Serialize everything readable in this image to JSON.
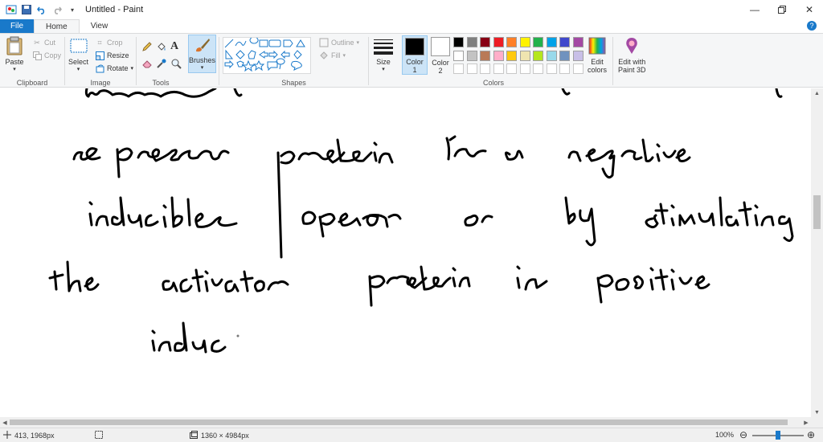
{
  "window": {
    "title": "Untitled - Paint"
  },
  "tabs": {
    "file": "File",
    "home": "Home",
    "view": "View"
  },
  "clipboard": {
    "paste": "Paste",
    "cut": "Cut",
    "copy": "Copy",
    "label": "Clipboard"
  },
  "image": {
    "select": "Select",
    "crop": "Crop",
    "resize": "Resize",
    "rotate": "Rotate",
    "label": "Image"
  },
  "tools": {
    "label": "Tools"
  },
  "brushes": {
    "label": "Brushes"
  },
  "shapes": {
    "outline": "Outline",
    "fill": "Fill",
    "label": "Shapes"
  },
  "size": {
    "label": "Size"
  },
  "colors": {
    "color1_label": "Color",
    "color1_num": "1",
    "color2_label": "Color",
    "color2_num": "2",
    "edit_label1": "Edit",
    "edit_label2": "colors",
    "paint3d_label1": "Edit with",
    "paint3d_label2": "Paint 3D",
    "label": "Colors",
    "color1": "#000000",
    "color2": "#ffffff",
    "palette_row1": [
      "#000000",
      "#7f7f7f",
      "#880015",
      "#ed1c24",
      "#ff7f27",
      "#fff200",
      "#22b14c",
      "#00a2e8",
      "#3f48cc",
      "#a349a4"
    ],
    "palette_row2": [
      "#ffffff",
      "#c3c3c3",
      "#b97a57",
      "#ffaec9",
      "#ffc90e",
      "#efe4b0",
      "#b5e61d",
      "#99d9ea",
      "#7092be",
      "#c8bfe7"
    ]
  },
  "canvas": {
    "handwriting_lines": [
      "transcription by",
      "repressor protein in a negative",
      "inducible operon or by stimulating",
      "the activator protein in positive",
      "induc"
    ]
  },
  "status": {
    "cursor_pos": "413, 1968px",
    "image_size": "1360 × 4984px",
    "zoom": "100%"
  }
}
